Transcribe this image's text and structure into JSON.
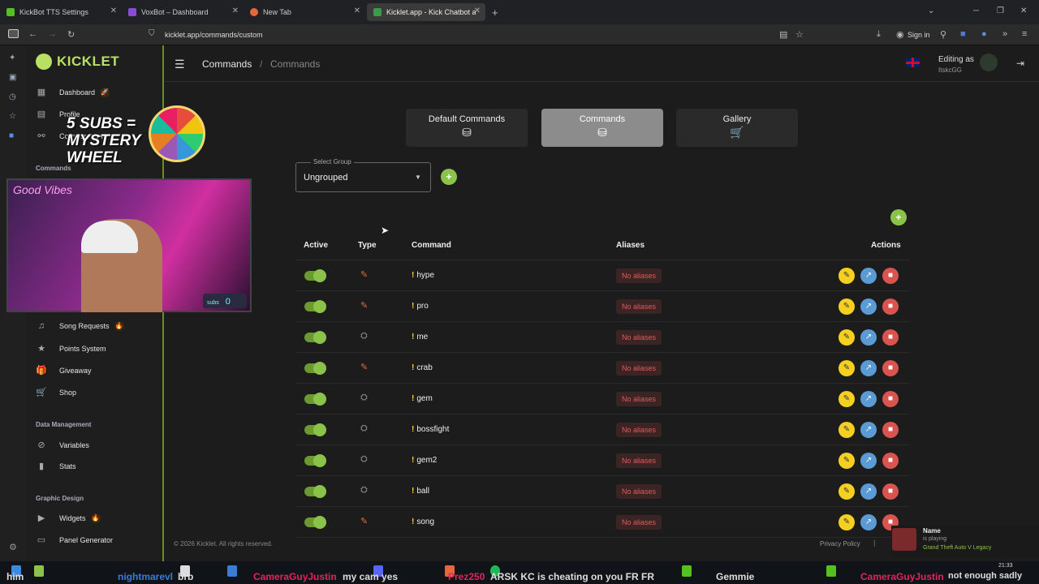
{
  "browser": {
    "tabs": [
      {
        "title": "KickBot TTS Settings",
        "color": "#53c11f"
      },
      {
        "title": "VoxBot – Dashboard",
        "color": "#8a4bd9"
      },
      {
        "title": "New Tab",
        "color": "#e8663a"
      },
      {
        "title": "Kicklet.app - Kick Chatbot and C",
        "color": "#3a9a4a"
      }
    ],
    "url": "kicklet.app/commands/custom",
    "signin_label": "Sign in"
  },
  "app": {
    "logo": "KICKLET",
    "breadcrumb": [
      "Commands",
      "/",
      "Commands"
    ],
    "editing_as_label": "Editing as",
    "username": "ItskcGG",
    "accent": "#8bc34a"
  },
  "sidebar": {
    "items_top": [
      {
        "label": "Dashboard",
        "icon": "dashboard-icon"
      },
      {
        "label": "Profile",
        "icon": "profile-icon"
      },
      {
        "label": "Collaborators",
        "icon": "collaborators-icon"
      }
    ],
    "section_commands": "Commands",
    "items_mid": [
      {
        "label": "Song Requests",
        "icon": "music-icon"
      },
      {
        "label": "Points System",
        "icon": "star-icon"
      },
      {
        "label": "Giveaway",
        "icon": "gift-icon"
      },
      {
        "label": "Shop",
        "icon": "cart-icon"
      }
    ],
    "section_data": "Data Management",
    "items_data": [
      {
        "label": "Variables",
        "icon": "variables-icon"
      },
      {
        "label": "Stats",
        "icon": "stats-icon"
      }
    ],
    "section_graphic": "Graphic Design",
    "items_graphic": [
      {
        "label": "Widgets",
        "icon": "widgets-icon"
      },
      {
        "label": "Panel Generator",
        "icon": "panel-icon"
      }
    ]
  },
  "overlay": {
    "promo_line1": "5 SUBS =",
    "promo_line2": "MYSTERY",
    "promo_line3": "WHEEL",
    "cam_sign": "Good Vibes",
    "subs_label": "subs",
    "subs_count": "0"
  },
  "tabs": [
    {
      "label": "Default Commands",
      "icon": "database-check-icon",
      "active": false
    },
    {
      "label": "Commands",
      "icon": "database-check-icon",
      "active": true
    },
    {
      "label": "Gallery",
      "icon": "cart-icon",
      "active": false
    }
  ],
  "group_select": {
    "label": "Select Group",
    "value": "Ungrouped"
  },
  "table": {
    "headers": {
      "active": "Active",
      "type": "Type",
      "command": "Command",
      "aliases": "Aliases",
      "actions": "Actions"
    },
    "rows": [
      {
        "name": "hype",
        "type": "pen",
        "aliases": "No aliases"
      },
      {
        "name": "pro",
        "type": "pen",
        "aliases": "No aliases"
      },
      {
        "name": "me",
        "type": "robot",
        "aliases": "No aliases"
      },
      {
        "name": "crab",
        "type": "pen",
        "aliases": "No aliases"
      },
      {
        "name": "gem",
        "type": "robot",
        "aliases": "No aliases"
      },
      {
        "name": "bossfight",
        "type": "robot",
        "aliases": "No aliases"
      },
      {
        "name": "gem2",
        "type": "robot",
        "aliases": "No aliases"
      },
      {
        "name": "ball",
        "type": "robot",
        "aliases": "No aliases"
      },
      {
        "name": "song",
        "type": "pen",
        "aliases": "No aliases"
      }
    ]
  },
  "footer": {
    "copyright": "© 2026 Kicklet. All rights reserved.",
    "privacy": "Privacy Policy",
    "separator": "|"
  },
  "now_playing": {
    "name": "Name",
    "status": "is playing",
    "game": "Grand Theft Auto V Legacy"
  },
  "clock": "21:33",
  "chat_ticker": [
    {
      "text": "him",
      "color": "#ffffff"
    },
    {
      "text": "nightmarevl",
      "color": "#3a7bd5"
    },
    {
      "text": "brb",
      "color": "#ffffff"
    },
    {
      "text": "CameraGuyJustin",
      "color": "#e0245e"
    },
    {
      "text": "my cam yes",
      "color": "#ffffff"
    },
    {
      "text": "Prez250",
      "color": "#e0245e"
    },
    {
      "text": "ARSK KC is cheating on you FR FR",
      "color": "#ffffff"
    },
    {
      "text": "Gemmie",
      "color": "#ffffff"
    },
    {
      "text": "CameraGuyJustin",
      "color": "#e0245e"
    },
    {
      "text": "not enough sadly",
      "color": "#ffffff"
    }
  ]
}
